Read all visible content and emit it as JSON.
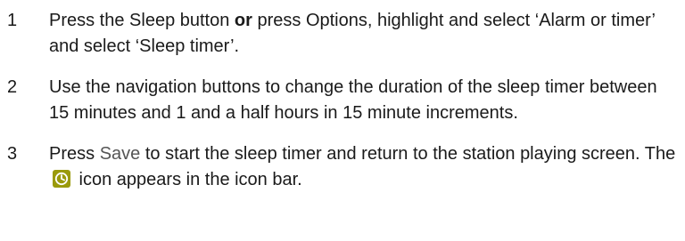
{
  "steps": [
    {
      "number": "1",
      "segments": {
        "a": "Press the Sleep button ",
        "b": "or",
        "c": " press Options, highlight and select ‘Alarm or timer’ and select ‘Sleep timer’."
      }
    },
    {
      "number": "2",
      "text": "Use the navigation buttons to change the duration of the sleep timer between 15 minutes and 1 and a half hours in 15 minute increments."
    },
    {
      "number": "3",
      "segments": {
        "a": "Press ",
        "save_label": "Save",
        "b": " to start the sleep timer and return to the station playing screen. The ",
        "c": " icon appears in the icon bar."
      },
      "icon": "sleep-timer-icon"
    }
  ],
  "colors": {
    "icon_bg": "#9a9a0b",
    "icon_fg": "#ffffff",
    "muted_text": "#555555"
  }
}
